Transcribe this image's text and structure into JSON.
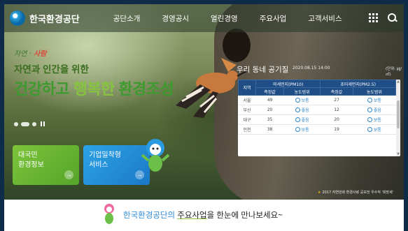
{
  "header": {
    "logo_text": "한국환경공단",
    "nav": [
      "공단소개",
      "경영공시",
      "열린경영",
      "주요사업",
      "고객서비스"
    ],
    "tools": [
      "grid-icon",
      "search-icon"
    ]
  },
  "hero": {
    "script_left": "자연",
    "script_right": "사람",
    "tagline_line1": "자연과 인간을 위한",
    "tagline_line2_a": "건강하고 ",
    "tagline_line2_b": "행복한",
    "tagline_line2_c": " 환경조성",
    "cards": [
      {
        "line1": "대국민",
        "line2": "환경정보"
      },
      {
        "line1": "기업밀착형",
        "line2": "서비스"
      }
    ],
    "copyright": "2017 자연만화 환경사랑 공모전 우수작 '희망새'"
  },
  "air_quality": {
    "title": "우리 동네 공기질",
    "date": "2020.08.15 14:00",
    "unit": "(단위: ㎍/㎥)",
    "group_headers": [
      "미세먼지(PM10)",
      "초미세먼지(PM2.5)"
    ],
    "col_region": "지역",
    "col_sub": [
      "측정값",
      "농도범위",
      "측정값",
      "농도범위"
    ],
    "rows": [
      {
        "region": "서울",
        "pm10": "49",
        "pm10_level": "보통",
        "pm25": "27",
        "pm25_level": "보통"
      },
      {
        "region": "부산",
        "pm10": "20",
        "pm10_level": "좋음",
        "pm25": "12",
        "pm25_level": "좋음"
      },
      {
        "region": "대구",
        "pm10": "35",
        "pm10_level": "좋음",
        "pm25": "20",
        "pm25_level": "보통"
      },
      {
        "region": "인천",
        "pm10": "38",
        "pm10_level": "보통",
        "pm25": "19",
        "pm25_level": "보통"
      }
    ]
  },
  "bottom": {
    "prefix": "한국환경공단의 ",
    "em": "주요사업",
    "suffix": "을 한눈에 만나보세요~"
  },
  "colors": {
    "nav_text": "#ffffff",
    "green_card": "#66b432",
    "blue_card": "#2290d6",
    "table_header": "#1f4e86",
    "accent_blue": "#2f8bd6"
  }
}
